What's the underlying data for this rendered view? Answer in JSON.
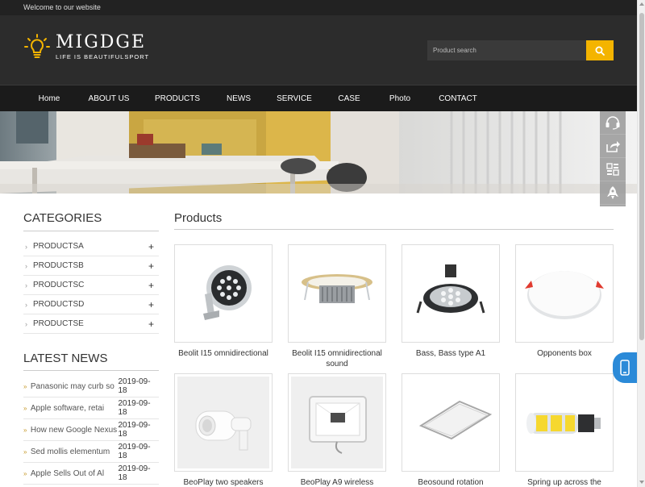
{
  "topbar": {
    "welcome": "Welcome to our website"
  },
  "brand": {
    "name": "MIGDGE",
    "tagline": "LIFE IS BEAUTIFULSPORT",
    "accent": "#f4b400"
  },
  "search": {
    "placeholder": "Product search",
    "icon": "search-icon"
  },
  "nav": [
    "Home",
    "ABOUT US",
    "PRODUCTS",
    "NEWS",
    "SERVICE",
    "CASE",
    "Photo",
    "CONTACT"
  ],
  "side_tools": [
    "headset-icon",
    "share-icon",
    "qrcode-icon",
    "rocket-icon"
  ],
  "categories": {
    "title": "CATEGORIES",
    "items": [
      "PRODUCTSA",
      "PRODUCTSB",
      "PRODUCTSC",
      "PRODUCTSD",
      "PRODUCTSE"
    ],
    "expand_symbol": "+"
  },
  "news": {
    "title": "LATEST NEWS",
    "items": [
      {
        "title": "Panasonic may curb so",
        "date": "2019-09-18"
      },
      {
        "title": "Apple software, retai",
        "date": "2019-09-18"
      },
      {
        "title": "How new Google Nexus",
        "date": "2019-09-18"
      },
      {
        "title": "Sed mollis elementum",
        "date": "2019-09-18"
      },
      {
        "title": "Apple Sells Out of Al",
        "date": "2019-09-18"
      }
    ]
  },
  "products": {
    "title": "Products",
    "items": [
      {
        "name": "Beolit I15 omnidirectional"
      },
      {
        "name": "Beolit I15 omnidirectional sound"
      },
      {
        "name": "Bass, Bass type A1"
      },
      {
        "name": "Opponents box"
      },
      {
        "name": "BeoPlay two speakers"
      },
      {
        "name": "BeoPlay A9 wireless"
      },
      {
        "name": "Beosound rotation"
      },
      {
        "name": "Spring up across the"
      }
    ]
  }
}
